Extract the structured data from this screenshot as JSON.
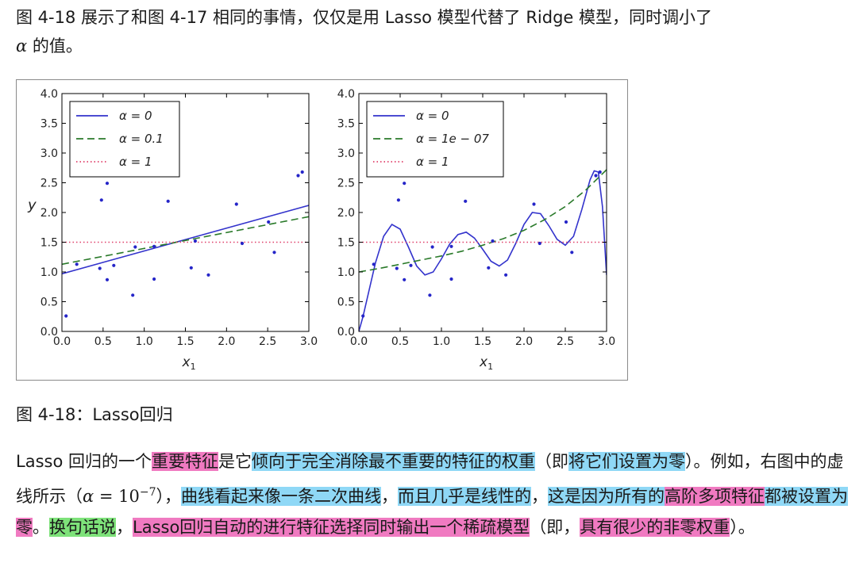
{
  "intro": {
    "line1": "图 4-18 展示了和图 4-17 相同的事情，仅仅是用 Lasso 模型代替了 Ridge 模型，同时调小了",
    "alpha_symbol": "α",
    "line2_rest": " 的值。"
  },
  "caption": "图 4-18：Lasso回归",
  "paragraph": {
    "s1": "Lasso 回归的一个",
    "s2": "重要特征",
    "s3": "是它",
    "s4": "倾向于完全消除最不重要的特征的权重",
    "s5": "（即",
    "s6": "将它们设置为零",
    "s7": "）。例如，右图中的虚线所示（",
    "math_lhs": "α",
    "math_eq": " = 10",
    "math_exp": "−7",
    "s8": "），",
    "s9": "曲线看起来像一条二次曲线",
    "s10": "，",
    "s11": "而且几乎是线性的",
    "s12": "，",
    "s13": "这是因为所有的",
    "s14": "高阶多项特征",
    "s15": "都被设置为",
    "s16": "零",
    "s17": "。",
    "s18": "换句话说",
    "s19": "，",
    "s20": "Lasso回归自动的进行特征选择同时输出一个稀疏模型",
    "s21": "（即，",
    "s22": "具有很少的非零权重",
    "s23": "）。"
  },
  "chart_data": [
    {
      "type": "scatter",
      "ylabel": "y",
      "xlabel": "x1",
      "xlim": [
        0,
        3.0
      ],
      "ylim": [
        0,
        4.0
      ],
      "xticks": [
        "0.0",
        "0.5",
        "1.0",
        "1.5",
        "2.0",
        "2.5",
        "3.0"
      ],
      "yticks": [
        "0.0",
        "0.5",
        "1.0",
        "1.5",
        "2.0",
        "2.5",
        "3.0",
        "3.5",
        "4.0"
      ],
      "legend_position": "top-left",
      "legend": [
        {
          "label": "α = 0",
          "style": "solid",
          "color": "#3333cc"
        },
        {
          "label": "α = 0.1",
          "style": "dashed",
          "color": "#2a7a2a"
        },
        {
          "label": "α = 1",
          "style": "dotted",
          "color": "#e0406a"
        }
      ],
      "points": [
        [
          0.05,
          0.26
        ],
        [
          0.18,
          1.13
        ],
        [
          0.46,
          1.06
        ],
        [
          0.48,
          2.21
        ],
        [
          0.55,
          0.87
        ],
        [
          0.55,
          2.49
        ],
        [
          0.63,
          1.11
        ],
        [
          0.86,
          0.61
        ],
        [
          0.89,
          1.42
        ],
        [
          1.12,
          0.88
        ],
        [
          1.12,
          1.43
        ],
        [
          1.29,
          2.19
        ],
        [
          1.57,
          1.07
        ],
        [
          1.62,
          1.52
        ],
        [
          1.78,
          0.95
        ],
        [
          2.12,
          2.14
        ],
        [
          2.19,
          1.48
        ],
        [
          2.51,
          1.84
        ],
        [
          2.58,
          1.33
        ],
        [
          2.87,
          2.62
        ],
        [
          2.92,
          2.68
        ]
      ],
      "series": [
        {
          "name": "α = 0",
          "style": "solid",
          "color": "#3333cc",
          "x": [
            0,
            3.0
          ],
          "y": [
            0.97,
            2.12
          ]
        },
        {
          "name": "α = 0.1",
          "style": "dashed",
          "color": "#2a7a2a",
          "x": [
            0,
            3.0
          ],
          "y": [
            1.13,
            1.93
          ]
        },
        {
          "name": "α = 1",
          "style": "dotted",
          "color": "#e0406a",
          "x": [
            0,
            3.0
          ],
          "y": [
            1.5,
            1.5
          ]
        }
      ]
    },
    {
      "type": "scatter",
      "xlabel": "x1",
      "xlim": [
        0,
        3.0
      ],
      "ylim": [
        0,
        4.0
      ],
      "xticks": [
        "0.0",
        "0.5",
        "1.0",
        "1.5",
        "2.0",
        "2.5",
        "3.0"
      ],
      "yticks": [
        "0.0",
        "0.5",
        "1.0",
        "1.5",
        "2.0",
        "2.5",
        "3.0",
        "3.5",
        "4.0"
      ],
      "legend_position": "top-left",
      "legend": [
        {
          "label": "α = 0",
          "style": "solid",
          "color": "#3333cc"
        },
        {
          "label": "α = 1e − 07",
          "style": "dashed",
          "color": "#2a7a2a"
        },
        {
          "label": "α = 1",
          "style": "dotted",
          "color": "#e0406a"
        }
      ],
      "points": [
        [
          0.05,
          0.26
        ],
        [
          0.18,
          1.13
        ],
        [
          0.46,
          1.06
        ],
        [
          0.48,
          2.21
        ],
        [
          0.55,
          0.87
        ],
        [
          0.55,
          2.49
        ],
        [
          0.63,
          1.11
        ],
        [
          0.86,
          0.61
        ],
        [
          0.89,
          1.42
        ],
        [
          1.12,
          0.88
        ],
        [
          1.12,
          1.43
        ],
        [
          1.29,
          2.19
        ],
        [
          1.57,
          1.07
        ],
        [
          1.62,
          1.52
        ],
        [
          1.78,
          0.95
        ],
        [
          2.12,
          2.14
        ],
        [
          2.19,
          1.48
        ],
        [
          2.51,
          1.84
        ],
        [
          2.58,
          1.33
        ],
        [
          2.87,
          2.62
        ],
        [
          2.92,
          2.68
        ]
      ],
      "series": [
        {
          "name": "α = 0",
          "style": "solid",
          "color": "#3333cc",
          "x": [
            0.0,
            0.05,
            0.1,
            0.2,
            0.3,
            0.4,
            0.5,
            0.6,
            0.7,
            0.8,
            0.9,
            1.0,
            1.1,
            1.2,
            1.3,
            1.4,
            1.5,
            1.6,
            1.7,
            1.8,
            1.9,
            2.0,
            2.1,
            2.2,
            2.3,
            2.4,
            2.5,
            2.6,
            2.7,
            2.8,
            2.85,
            2.9,
            2.95,
            3.0
          ],
          "y": [
            0.0,
            0.25,
            0.55,
            1.15,
            1.6,
            1.8,
            1.72,
            1.42,
            1.1,
            0.95,
            1.0,
            1.22,
            1.47,
            1.63,
            1.67,
            1.57,
            1.38,
            1.18,
            1.1,
            1.2,
            1.48,
            1.8,
            2.0,
            1.98,
            1.78,
            1.55,
            1.45,
            1.6,
            2.05,
            2.55,
            2.7,
            2.68,
            2.1,
            0.95
          ]
        },
        {
          "name": "α = 1e − 07",
          "style": "dashed",
          "color": "#2a7a2a",
          "x": [
            0.0,
            0.25,
            0.5,
            0.75,
            1.0,
            1.25,
            1.5,
            1.75,
            2.0,
            2.25,
            2.5,
            2.75,
            3.0
          ],
          "y": [
            1.0,
            1.06,
            1.13,
            1.2,
            1.27,
            1.35,
            1.45,
            1.56,
            1.7,
            1.88,
            2.1,
            2.38,
            2.72
          ]
        },
        {
          "name": "α = 1",
          "style": "dotted",
          "color": "#e0406a",
          "x": [
            0,
            3.0
          ],
          "y": [
            1.5,
            1.5
          ]
        }
      ]
    }
  ]
}
